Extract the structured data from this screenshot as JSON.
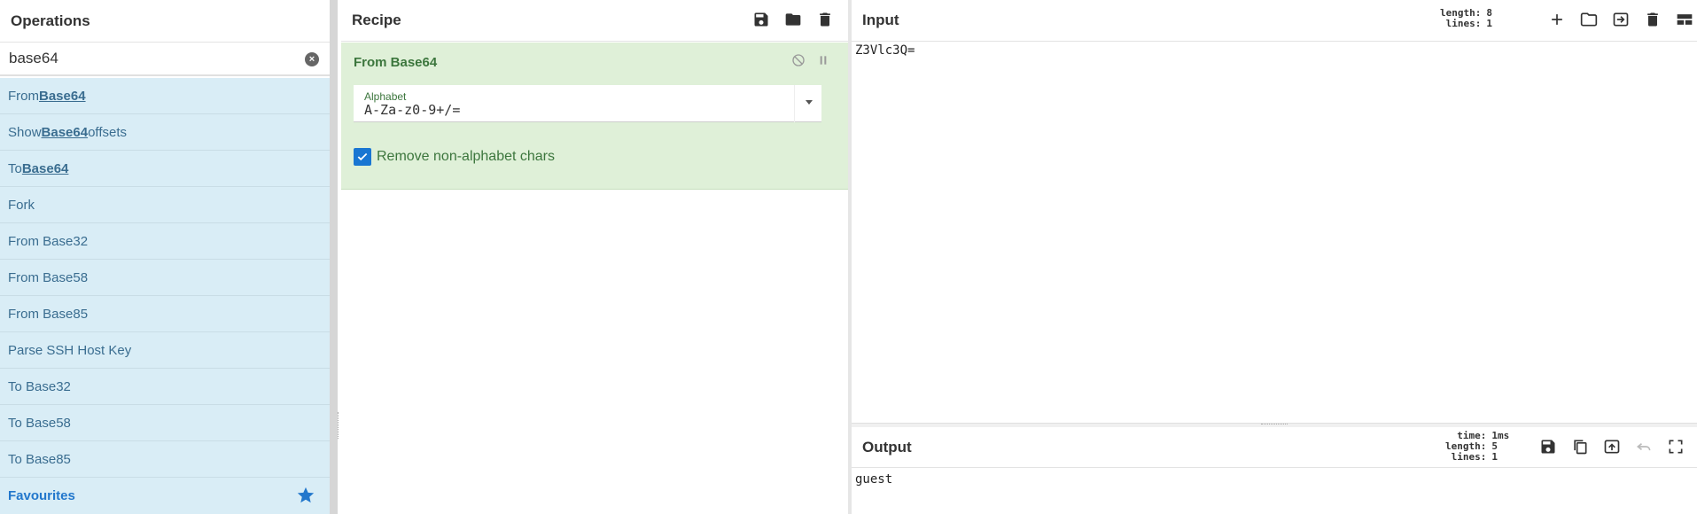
{
  "operations": {
    "title": "Operations",
    "search_value": "base64",
    "items": [
      {
        "pre": "From ",
        "match": "Base64",
        "post": ""
      },
      {
        "pre": "Show ",
        "match": "Base64",
        "post": " offsets"
      },
      {
        "pre": "To ",
        "match": "Base64",
        "post": ""
      },
      {
        "pre": "Fork",
        "match": "",
        "post": ""
      },
      {
        "pre": "From Base32",
        "match": "",
        "post": ""
      },
      {
        "pre": "From Base58",
        "match": "",
        "post": ""
      },
      {
        "pre": "From Base85",
        "match": "",
        "post": ""
      },
      {
        "pre": "Parse SSH Host Key",
        "match": "",
        "post": ""
      },
      {
        "pre": "To Base32",
        "match": "",
        "post": ""
      },
      {
        "pre": "To Base58",
        "match": "",
        "post": ""
      },
      {
        "pre": "To Base85",
        "match": "",
        "post": ""
      }
    ],
    "favourites_label": "Favourites"
  },
  "recipe": {
    "title": "Recipe",
    "operation": {
      "name": "From Base64",
      "alphabet_label": "Alphabet",
      "alphabet_value": "A-Za-z0-9+/=",
      "remove_label": "Remove non-alphabet chars",
      "remove_checked": true
    }
  },
  "input": {
    "title": "Input",
    "length_key": "length:",
    "length_val": "8",
    "lines_key": "lines:",
    "lines_val": "1",
    "text": "Z3Vlc3Q="
  },
  "output": {
    "title": "Output",
    "time_key": "time:",
    "time_val": "1ms",
    "length_key": "length:",
    "length_val": "5",
    "lines_key": "lines:",
    "lines_val": "1",
    "text": "guest"
  },
  "colors": {
    "accent": "#1976d2",
    "op_list_bg": "#d9edf6",
    "recipe_op_bg": "#dff0d8",
    "recipe_op_text": "#3c763d"
  }
}
